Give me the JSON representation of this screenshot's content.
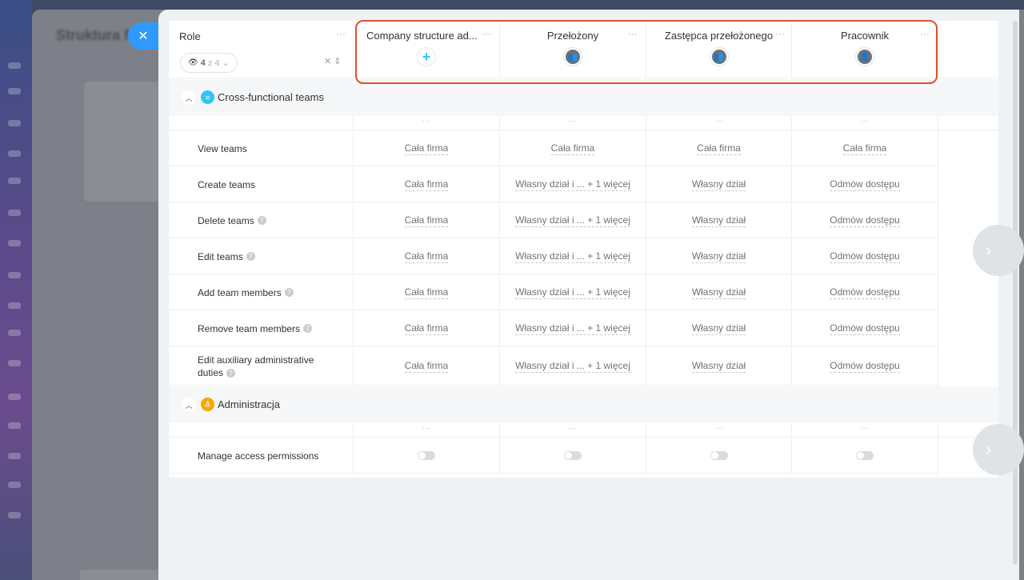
{
  "background": {
    "app_title": "Struktura f"
  },
  "header": {
    "role_title": "Role",
    "counter": {
      "visible": "4",
      "of": "z 4"
    },
    "columns": [
      {
        "title": "Company structure ad...",
        "icon": "plus-icon"
      },
      {
        "title": "Przełożony",
        "icon": "group-icon"
      },
      {
        "title": "Zastępca przełożonego",
        "icon": "group-icon"
      },
      {
        "title": "Pracownik",
        "icon": "user-icon"
      }
    ]
  },
  "sections": [
    {
      "title": "Cross-functional teams",
      "icon_color": "#2fc6f6",
      "rows": [
        {
          "label": "View teams",
          "help": false,
          "values": [
            "Cała firma",
            "Cała firma",
            "Cała firma",
            "Cała firma"
          ]
        },
        {
          "label": "Create teams",
          "help": false,
          "values": [
            "Cała firma",
            "Własny dział i ... + 1 więcej",
            "Własny dział",
            "Odmów dostępu"
          ]
        },
        {
          "label": "Delete teams",
          "help": true,
          "values": [
            "Cała firma",
            "Własny dział i ... + 1 więcej",
            "Własny dział",
            "Odmów dostępu"
          ]
        },
        {
          "label": "Edit teams",
          "help": true,
          "values": [
            "Cała firma",
            "Własny dział i ... + 1 więcej",
            "Własny dział",
            "Odmów dostępu"
          ]
        },
        {
          "label": "Add team members",
          "help": true,
          "values": [
            "Cała firma",
            "Własny dział i ... + 1 więcej",
            "Własny dział",
            "Odmów dostępu"
          ]
        },
        {
          "label": "Remove team members",
          "help": true,
          "values": [
            "Cała firma",
            "Własny dział i ... + 1 więcej",
            "Własny dział",
            "Odmów dostępu"
          ]
        },
        {
          "label": "Edit auxiliary administrative duties",
          "help": true,
          "values": [
            "Cała firma",
            "Własny dział i ... + 1 więcej",
            "Własny dział",
            "Odmów dostępu"
          ]
        }
      ]
    },
    {
      "title": "Administracja",
      "icon_color": "#f7a700",
      "rows": [
        {
          "label": "Manage access permissions",
          "help": false,
          "toggles": [
            false,
            false,
            false,
            false
          ]
        }
      ]
    }
  ],
  "colors": {
    "accent": "#2e9afe",
    "highlight": "#e0502d"
  }
}
